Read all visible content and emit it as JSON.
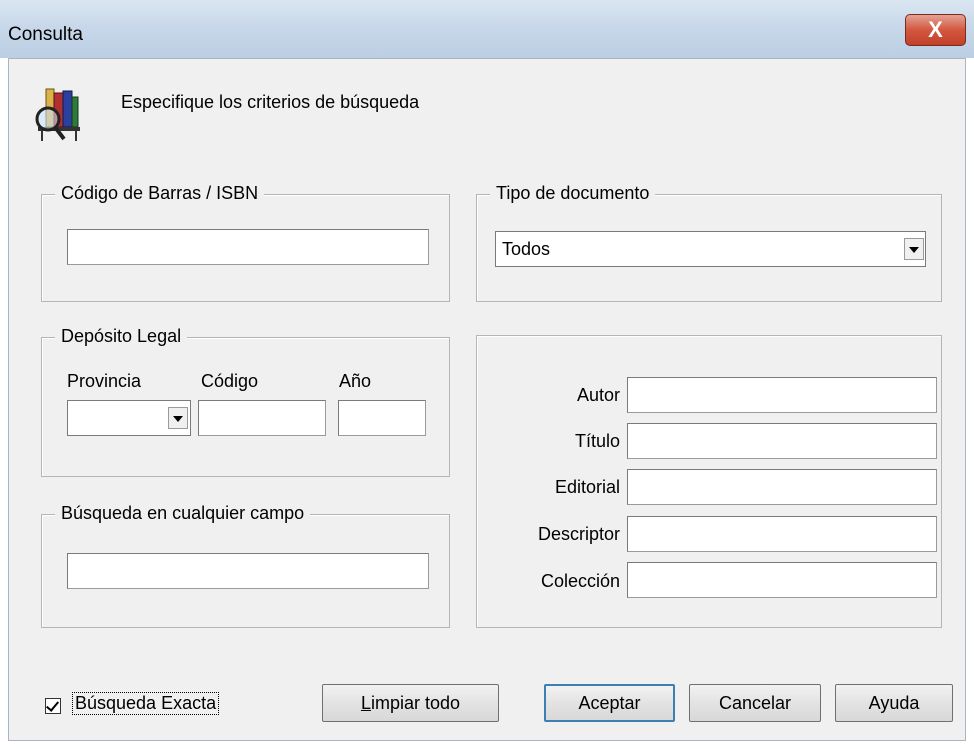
{
  "window": {
    "title": "Consulta",
    "close_glyph": "X"
  },
  "header": {
    "icon": "library-search-icon",
    "instruction": "Especifique los criterios de búsqueda"
  },
  "barcode_group": {
    "legend": "Código de Barras  /  ISBN",
    "value": ""
  },
  "doc_type_group": {
    "legend": "Tipo de documento",
    "selected": "Todos"
  },
  "legal_deposit_group": {
    "legend": "Depósito Legal",
    "province_label": "Provincia",
    "code_label": "Código",
    "year_label": "Año",
    "province_value": "",
    "code_value": "",
    "year_value": ""
  },
  "any_field_group": {
    "legend": "Búsqueda en cualquier campo",
    "value": ""
  },
  "fields": {
    "author_label": "Autor",
    "title_label": "Título",
    "publisher_label": "Editorial",
    "descriptor_label": "Descriptor",
    "collection_label": "Colección"
  },
  "footer": {
    "exact_search_label": "Búsqueda Exacta",
    "exact_search_checked": true,
    "clear_all_label_first": "L",
    "clear_all_label_rest": "impiar todo",
    "accept_label": "Aceptar",
    "cancel_label": "Cancelar",
    "help_label": "Ayuda"
  }
}
